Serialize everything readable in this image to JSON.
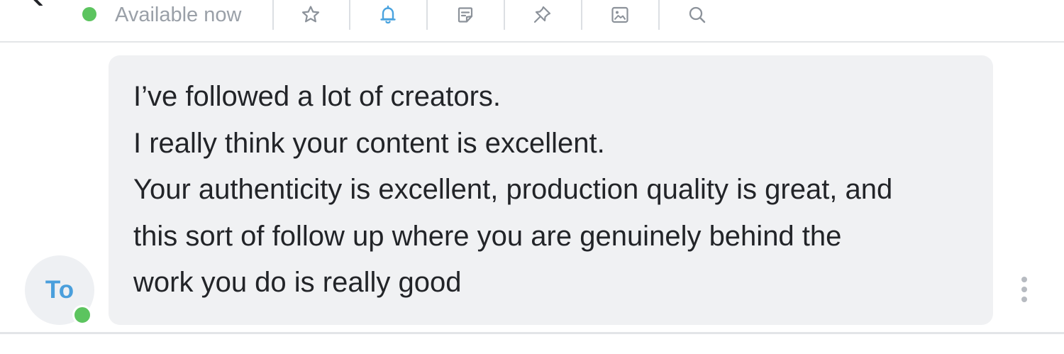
{
  "header": {
    "status": {
      "label": "Available now",
      "color": "#5cc45f"
    },
    "toolbar_icons": [
      {
        "name": "star-icon",
        "color": "#8c929a"
      },
      {
        "name": "bell-icon",
        "color": "#4aa3df"
      },
      {
        "name": "note-icon",
        "color": "#8c929a"
      },
      {
        "name": "pin-icon",
        "color": "#8c929a"
      },
      {
        "name": "image-icon",
        "color": "#8c929a"
      },
      {
        "name": "search-icon",
        "color": "#8c929a"
      }
    ]
  },
  "message": {
    "avatar": {
      "initials": "To",
      "online_color": "#5cc45f"
    },
    "lines": [
      "I’ve followed a lot of creators.",
      "I really think your content is excellent.",
      "Your authenticity is excellent, production quality is great, and",
      "this sort of follow up where you are genuinely behind the",
      "work you do is really good"
    ],
    "more_icon": "vertical-ellipsis-icon"
  }
}
